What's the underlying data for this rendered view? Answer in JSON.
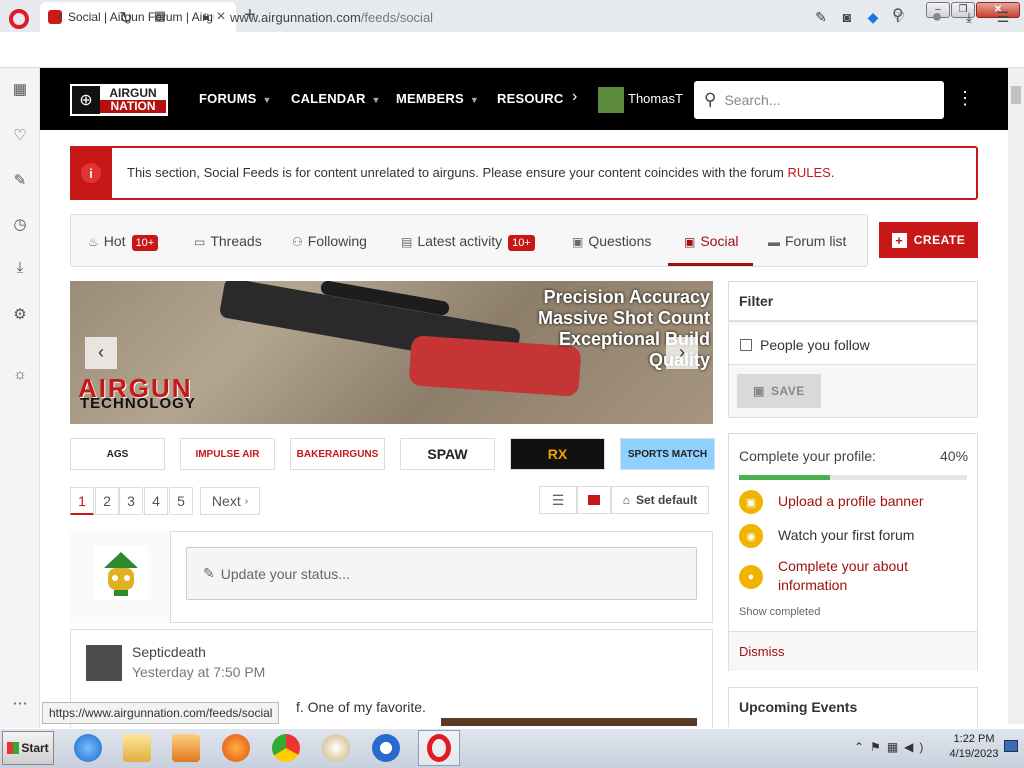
{
  "browser": {
    "tab_title": "Social | Airgun Forum | Airgun",
    "url_host": "www.airgunnation.com",
    "url_path": "/feeds/social",
    "status_url": "https://www.airgunnation.com/feeds/social"
  },
  "site": {
    "logo_top": "AIRGUN",
    "logo_bottom": "NATION",
    "nav": [
      "FORUMS",
      "CALENDAR",
      "MEMBERS",
      "RESOURCES"
    ],
    "username": "ThomasT",
    "search_placeholder": "Search..."
  },
  "notice": {
    "text": "This section, Social Feeds is for content unrelated to airguns. Please ensure your content coincides with the forum ",
    "link": "RULES",
    "end": "."
  },
  "tabs": {
    "hot": "Hot",
    "hot_badge": "10+",
    "threads": "Threads",
    "following": "Following",
    "latest": "Latest activity",
    "latest_badge": "10+",
    "questions": "Questions",
    "social": "Social",
    "forum_list": "Forum list",
    "create": "CREATE"
  },
  "banner": {
    "line1": "Precision Accuracy",
    "line2": "Massive Shot Count",
    "line3": "Exceptional Build",
    "line4": "Quality",
    "brand1": "AIRGUN",
    "brand2": "TECHNOLOGY"
  },
  "sponsors": [
    "AGS",
    "IMPULSE AIR",
    "BAKERAIRGUNS",
    "SPAW",
    "RX",
    "SPORTS MATCH"
  ],
  "pagination": {
    "pages": [
      "1",
      "2",
      "3",
      "4",
      "5"
    ],
    "next": "Next",
    "set_default": "Set default"
  },
  "status": {
    "placeholder": "Update your status..."
  },
  "post": {
    "author": "Septicdeath",
    "time": "Yesterday at 7:50 PM",
    "body": "f. One of my favorite."
  },
  "filter": {
    "title": "Filter",
    "option": "People you follow",
    "save": "SAVE"
  },
  "profile": {
    "title": "Complete your profile:",
    "percent_label": "40%",
    "progress": 0.4,
    "steps": [
      "Upload a profile banner",
      "Watch your first forum",
      "Complete your about information"
    ],
    "show_completed": "Show completed",
    "dismiss": "Dismiss"
  },
  "events": {
    "title": "Upcoming Events"
  },
  "taskbar": {
    "start": "Start",
    "time": "1:22 PM",
    "date": "4/19/2023"
  },
  "colors": {
    "accent": "#c81717",
    "header": "#000000",
    "progress": "#4caf50"
  }
}
